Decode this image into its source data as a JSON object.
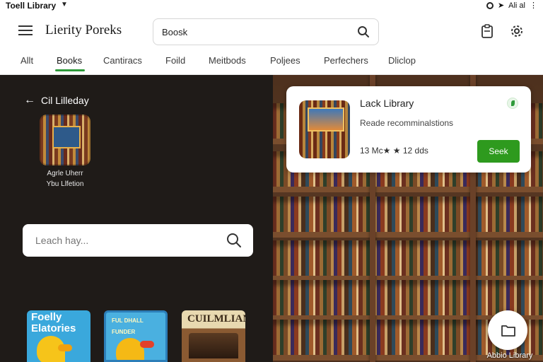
{
  "status_bar": {
    "title": "Toell Library",
    "right_text": "Ali al"
  },
  "app_bar": {
    "title": "Lierity Poreks",
    "search_value": "Boosk"
  },
  "tabs": [
    {
      "label": "Allt"
    },
    {
      "label": "Books"
    },
    {
      "label": "Cantiracs"
    },
    {
      "label": "Foild"
    },
    {
      "label": "Meitbods"
    },
    {
      "label": "Poljees"
    },
    {
      "label": "Perfechers"
    },
    {
      "label": "Dliclop"
    }
  ],
  "active_tab": "Books",
  "sidebar": {
    "title": "Cil Lilleday",
    "caption_line1": "Agrle Uherr",
    "caption_line2": "Ybu Llfetion",
    "search_placeholder": "Leach hay..."
  },
  "books": [
    {
      "title_line1": "Foelly",
      "title_line2": "Elatories"
    },
    {
      "title_line1": "FUL DHALL FUNDER",
      "title_line2": ""
    },
    {
      "title_line1": "CUILMLIAN",
      "title_line2": ""
    }
  ],
  "card": {
    "title": "Lack Library",
    "subtitle": "Reade recomminalstions",
    "meta": "13 Mc★ ★ 12 dds",
    "button_label": "Seek"
  },
  "fab": {
    "label": "Abbio Library"
  },
  "colors": {
    "accent_green": "#2e9a3a",
    "button_green": "#2e9a1e",
    "dark_panel": "#1f1b18"
  }
}
